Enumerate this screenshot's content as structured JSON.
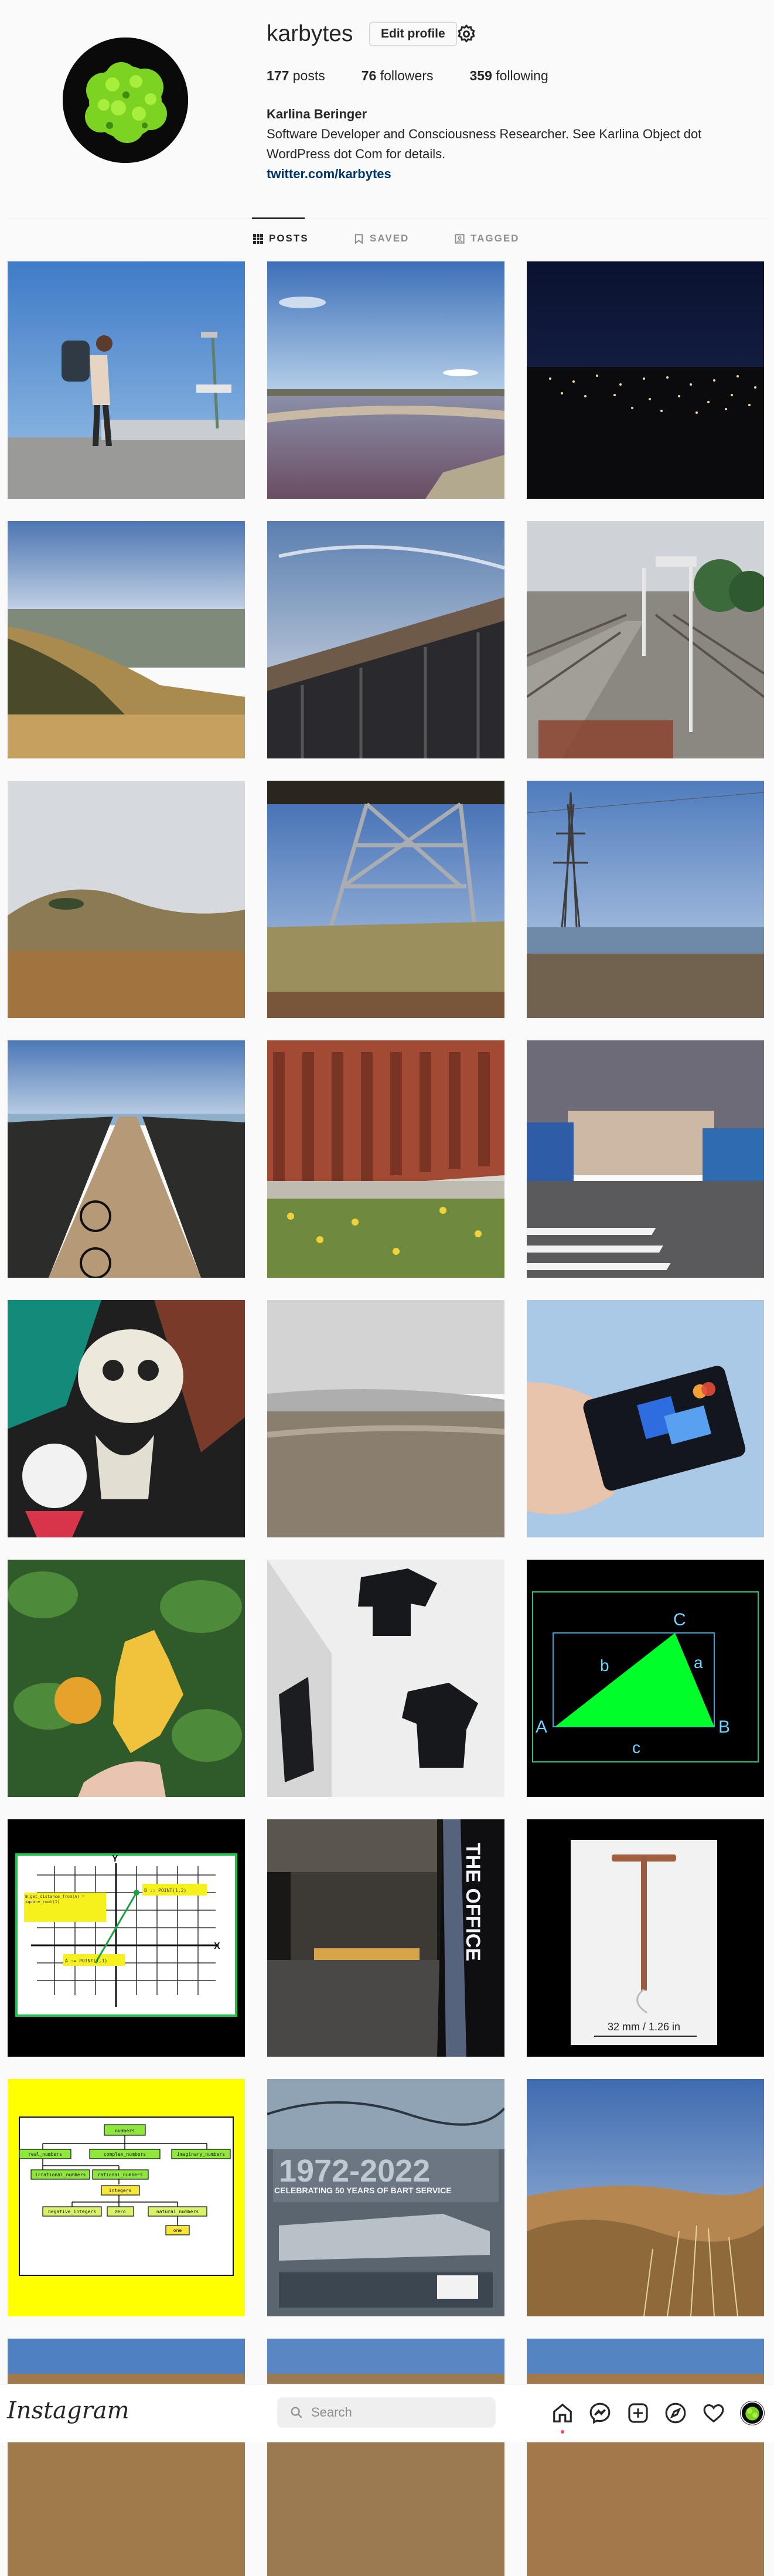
{
  "profile": {
    "username": "karbytes",
    "edit_label": "Edit profile",
    "posts_count": "177",
    "posts_label": "posts",
    "followers_count": "76",
    "followers_label": "followers",
    "following_count": "359",
    "following_label": "following",
    "full_name": "Karlina Beringer",
    "bio_line1": "Software Developer and Consciousness Researcher. See Karlina Object dot",
    "bio_line2": "WordPress dot Com for details.",
    "link": "twitter.com/karbytes"
  },
  "tabs": [
    {
      "label": "POSTS",
      "active": true
    },
    {
      "label": "SAVED",
      "active": false
    },
    {
      "label": "TAGGED",
      "active": false
    }
  ],
  "posts": {
    "math_triangle": {
      "a": "a",
      "b": "b",
      "c": "c",
      "A": "A",
      "B": "B",
      "C": "C"
    },
    "graph_post": {
      "y_axis": "Y",
      "x_axis": "X",
      "label_b": "B := POINT(1,2)",
      "label_a": "A := POINT(1,1)",
      "note": "B.get_distance_from(A) = square_root(1)"
    },
    "iud_caption": "32 mm / 1.26 in",
    "office_sign": "THE OFFICE",
    "bart_text": "CELEBRATING 50 YEARS OF BART SERVICE",
    "bart_years": "1972-2022",
    "numbers_chart": {
      "root": "numbers",
      "level1": [
        "real_numbers",
        "complex_numbers",
        "imaginary_numbers"
      ],
      "level2": [
        "irrational_numbers",
        "rational_numbers"
      ],
      "level3": "integers",
      "level4": [
        "negative_integers",
        "zero",
        "natural_numbers"
      ],
      "level5": "one"
    }
  },
  "nav": {
    "logo": "Instagram",
    "search_placeholder": "Search"
  },
  "colors": {
    "accent_link": "#00376b",
    "notification_dot": "#ed4956",
    "border": "#dbdbdb"
  }
}
